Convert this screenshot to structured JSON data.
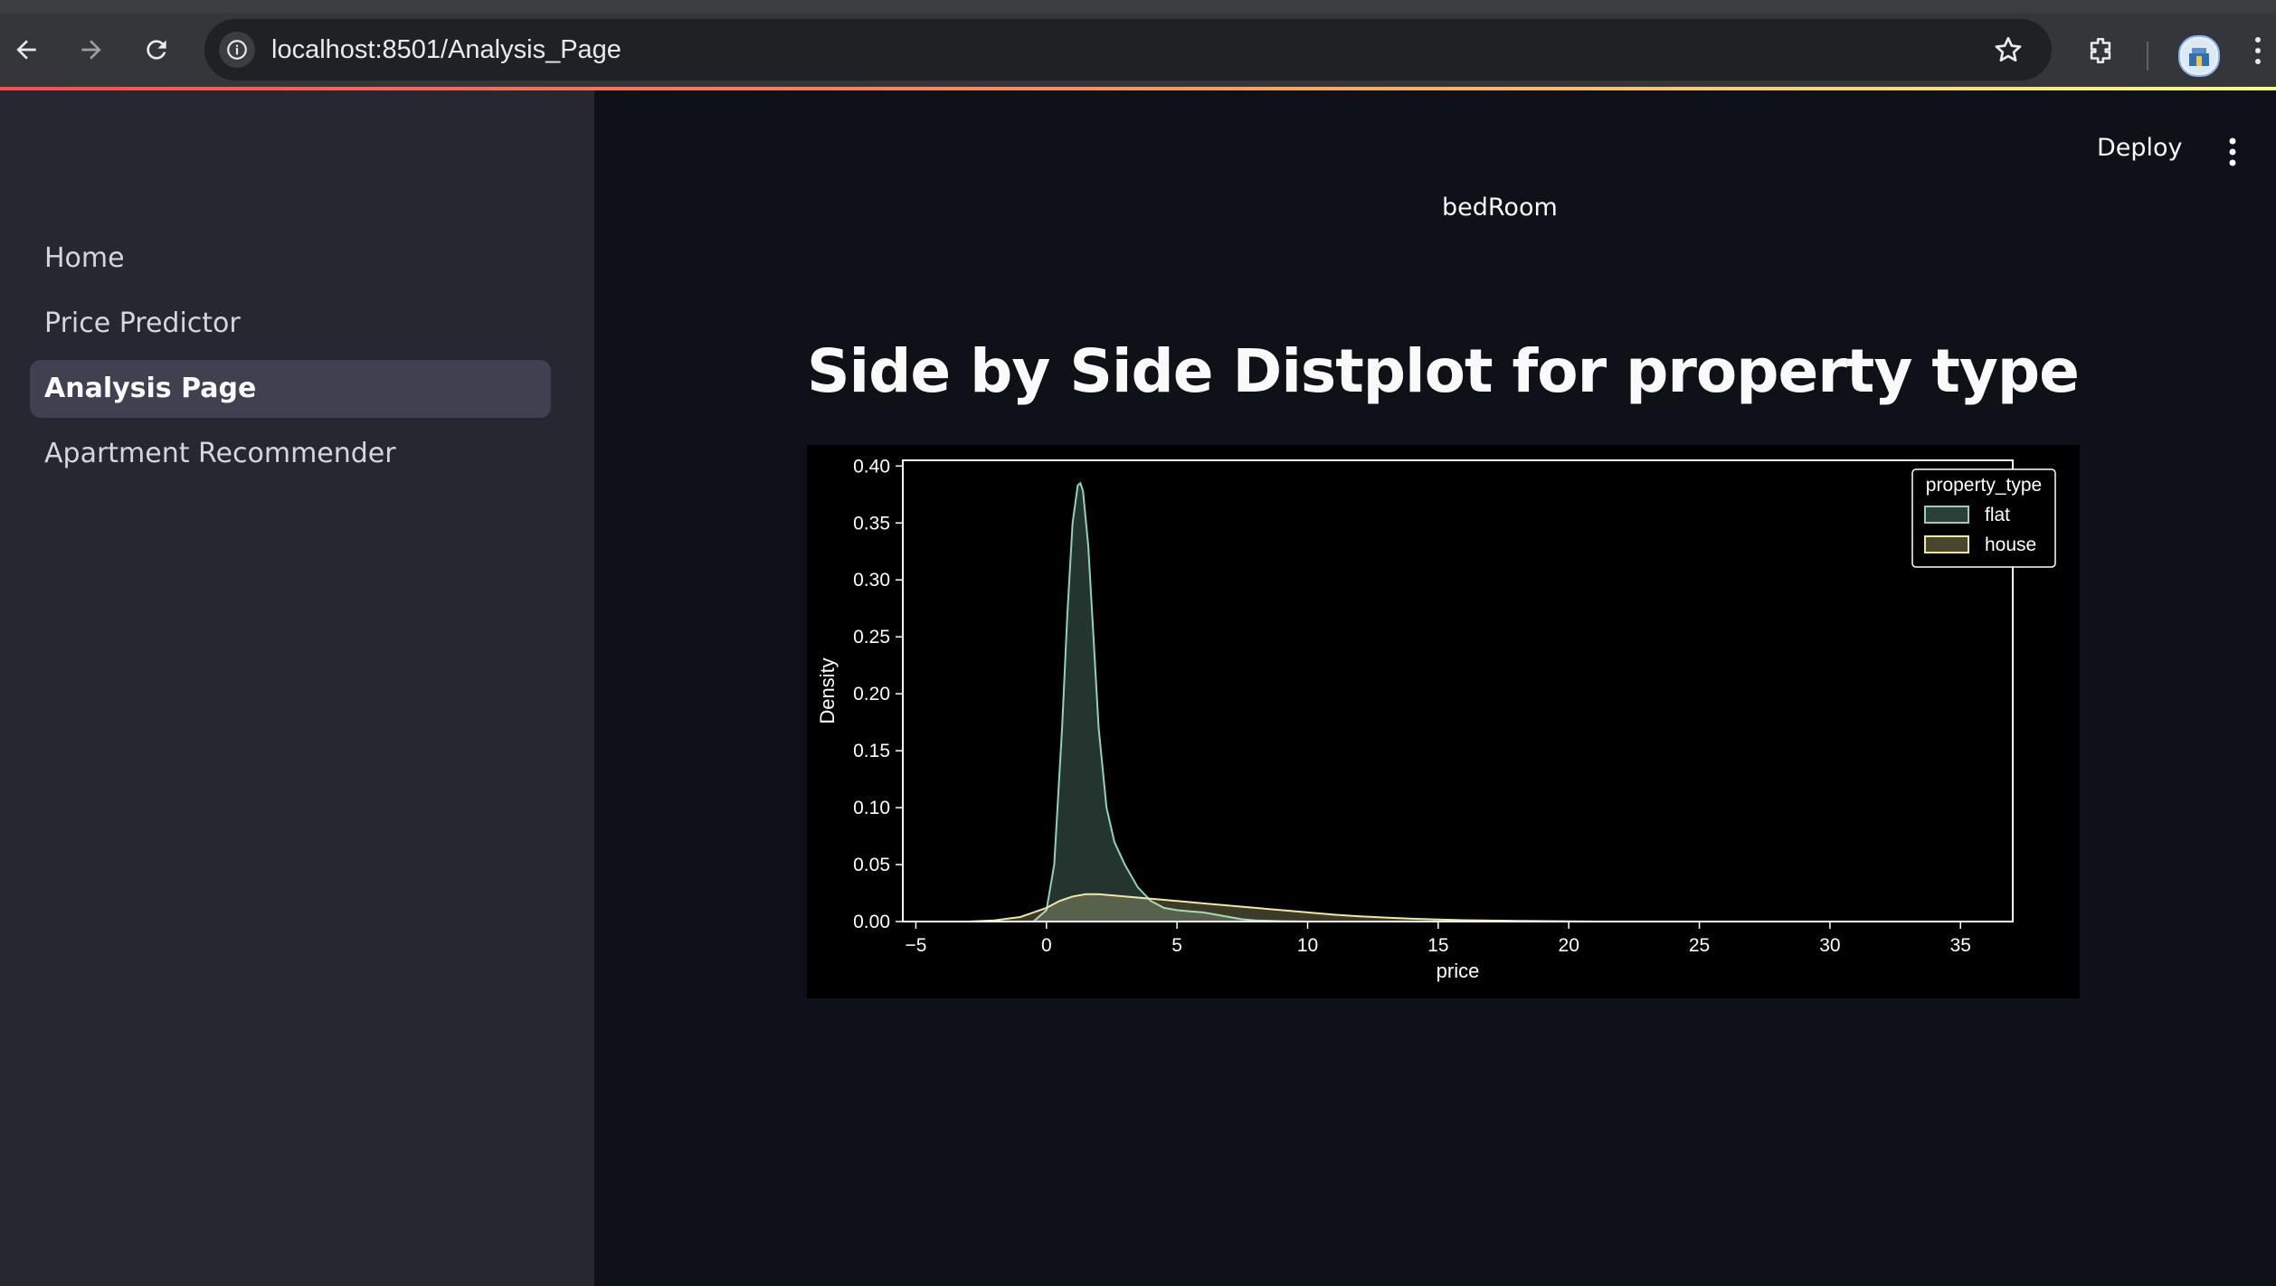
{
  "browser": {
    "url": "localhost:8501/Analysis_Page"
  },
  "app": {
    "deploy_label": "Deploy",
    "header_label": "bedRoom",
    "page_title": "Side by Side Distplot for property type"
  },
  "sidebar": {
    "items": [
      {
        "label": "Home",
        "active": false
      },
      {
        "label": "Price Predictor",
        "active": false
      },
      {
        "label": "Analysis Page",
        "active": true
      },
      {
        "label": "Apartment Recommender",
        "active": false
      }
    ]
  },
  "colors": {
    "flat": "#8fd3bc",
    "house": "#f2e8a0",
    "accent_gradient": [
      "#ff4b4b",
      "#fffd80"
    ]
  },
  "chart_data": {
    "type": "area",
    "title": "",
    "xlabel": "price",
    "ylabel": "Density",
    "xlim": [
      -5.5,
      37
    ],
    "ylim": [
      0,
      0.405
    ],
    "x_ticks": [
      -5,
      0,
      5,
      10,
      15,
      20,
      25,
      30,
      35
    ],
    "x_tick_labels": [
      "−5",
      "0",
      "5",
      "10",
      "15",
      "20",
      "25",
      "30",
      "35"
    ],
    "y_ticks": [
      0.0,
      0.05,
      0.1,
      0.15,
      0.2,
      0.25,
      0.3,
      0.35,
      0.4
    ],
    "y_tick_labels": [
      "0.00",
      "0.05",
      "0.10",
      "0.15",
      "0.20",
      "0.25",
      "0.30",
      "0.35",
      "0.40"
    ],
    "legend": {
      "title": "property_type",
      "position": "top-right"
    },
    "series": [
      {
        "name": "flat",
        "x": [
          -0.5,
          0,
          0.3,
          0.6,
          0.8,
          1.0,
          1.2,
          1.3,
          1.4,
          1.6,
          1.8,
          2.0,
          2.3,
          2.6,
          3.0,
          3.5,
          4.0,
          4.5,
          5.0,
          5.5,
          6.0,
          6.5,
          7.0,
          7.5,
          8.0,
          9.0,
          10.0
        ],
        "y": [
          0,
          0.01,
          0.05,
          0.17,
          0.27,
          0.35,
          0.383,
          0.385,
          0.378,
          0.33,
          0.25,
          0.17,
          0.1,
          0.07,
          0.05,
          0.03,
          0.018,
          0.012,
          0.01,
          0.009,
          0.008,
          0.006,
          0.004,
          0.002,
          0.001,
          0.0003,
          0
        ]
      },
      {
        "name": "house",
        "x": [
          -3,
          -2,
          -1,
          0,
          0.5,
          1,
          1.5,
          2,
          3,
          4,
          5,
          6,
          7,
          8,
          9,
          10,
          11,
          12,
          13,
          14,
          15,
          16,
          17,
          18,
          19,
          20,
          21
        ],
        "y": [
          0,
          0.001,
          0.004,
          0.012,
          0.018,
          0.022,
          0.024,
          0.024,
          0.022,
          0.02,
          0.018,
          0.016,
          0.014,
          0.012,
          0.01,
          0.008,
          0.006,
          0.0045,
          0.0035,
          0.0025,
          0.0018,
          0.0012,
          0.0009,
          0.0006,
          0.0004,
          0.0002,
          0
        ]
      }
    ]
  }
}
